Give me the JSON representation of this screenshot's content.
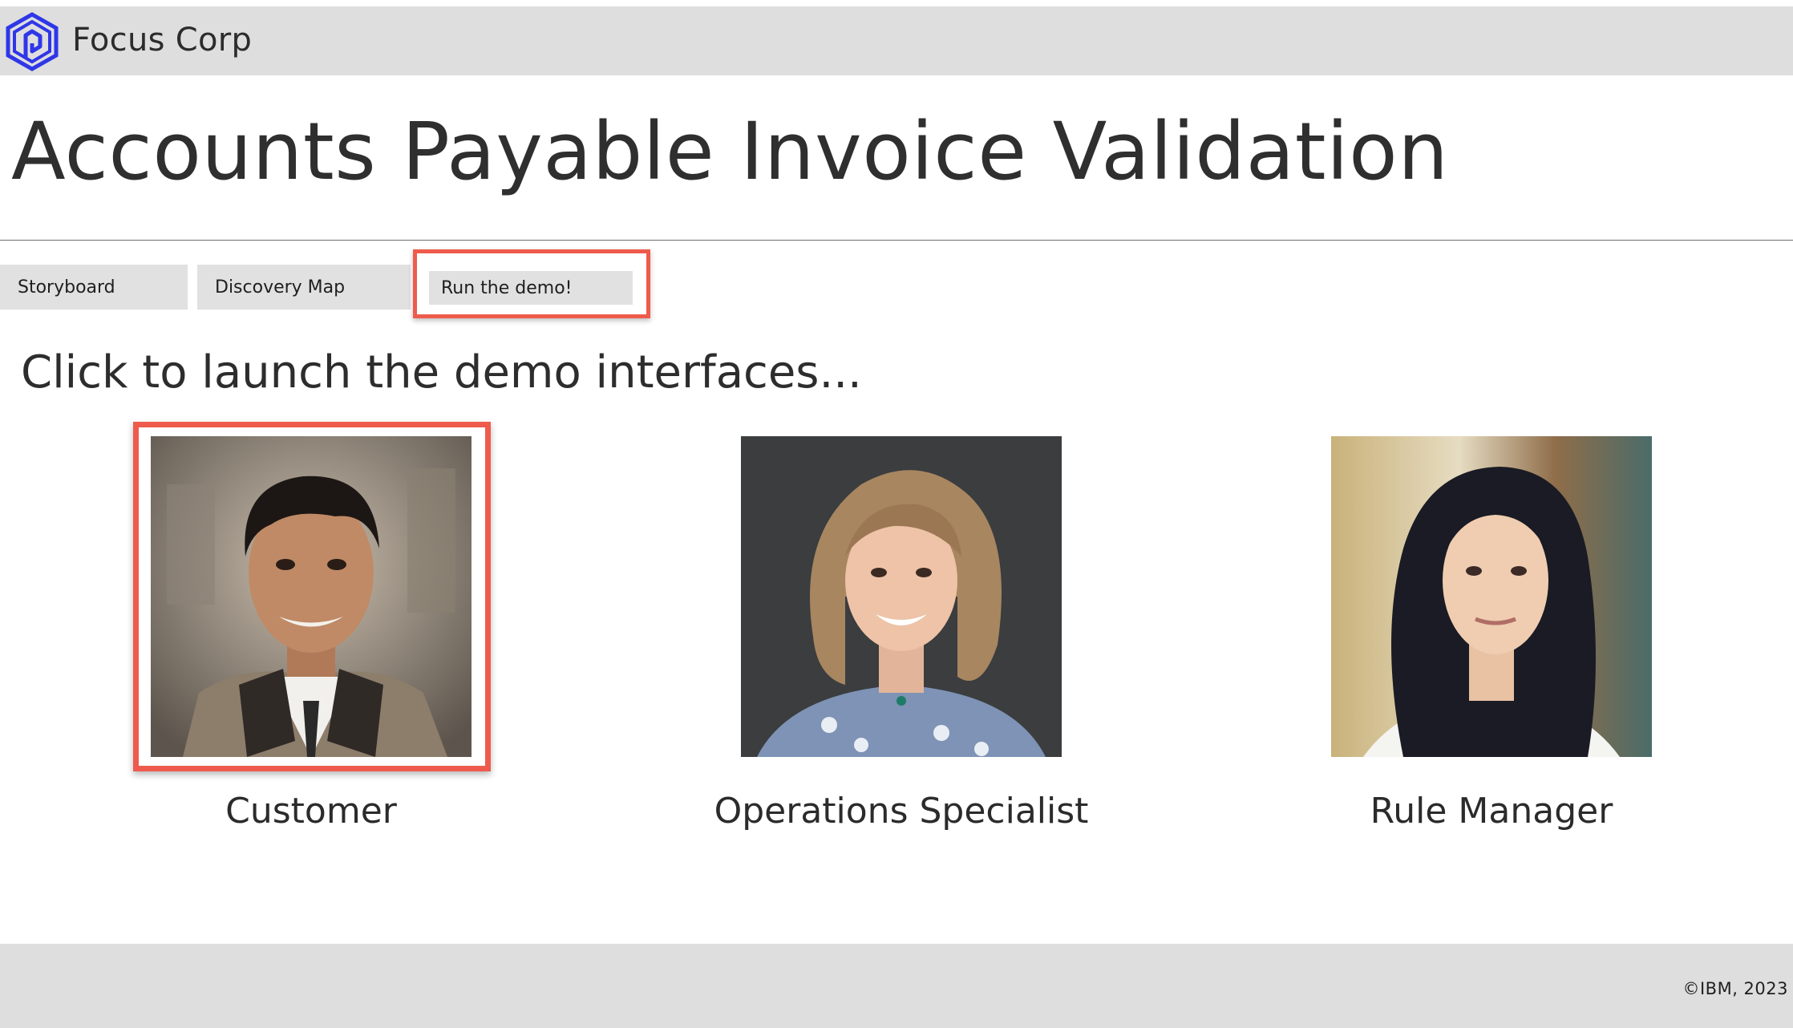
{
  "header": {
    "brand": "Focus Corp",
    "logo_icon": "hexagon-logo-icon",
    "logo_color": "#2f36e8"
  },
  "title": "Accounts Payable Invoice Validation",
  "tabs": [
    {
      "label": "Storyboard",
      "highlighted": false
    },
    {
      "label": "Discovery Map",
      "highlighted": false
    },
    {
      "label": "Run the demo!",
      "highlighted": true
    }
  ],
  "subtitle": "Click to launch the demo interfaces...",
  "personas": [
    {
      "label": "Customer",
      "highlighted": true
    },
    {
      "label": "Operations Specialist",
      "highlighted": false
    },
    {
      "label": "Rule Manager",
      "highlighted": false
    }
  ],
  "footer": {
    "copyright": "©IBM, 2023"
  },
  "colors": {
    "highlight": "#ee5b4c",
    "bar_background": "#dedede",
    "tab_background": "#e1e1e1"
  }
}
